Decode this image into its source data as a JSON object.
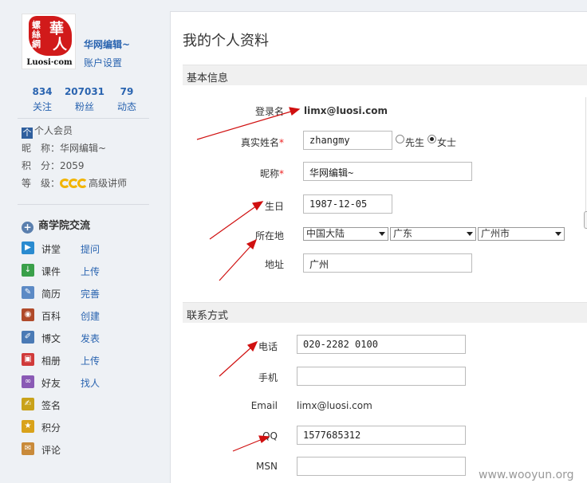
{
  "logo": {
    "seal_chars": [
      "華",
      "人",
      "螺絲網"
    ],
    "wordmark": "Luosi·com"
  },
  "user": {
    "name": "华网编辑~",
    "account_settings": "账户设置"
  },
  "stats": [
    {
      "num": "834",
      "label": "关注"
    },
    {
      "num": "207031",
      "label": "粉丝"
    },
    {
      "num": "79",
      "label": "动态"
    }
  ],
  "profile_info": {
    "member_icon": "个",
    "member": "个人会员",
    "nick_label": "昵　称：",
    "nick": "华网编辑~",
    "points_label": "积　分：",
    "points": "2059",
    "level_label": "等　级：",
    "level": "高级讲师"
  },
  "section": {
    "icon": "+",
    "title": "商学院交流"
  },
  "nav": [
    {
      "icon": "lecture-icon",
      "color": "#2a8bd0",
      "label": "讲堂",
      "action": "提问"
    },
    {
      "icon": "course-icon",
      "color": "#3aa04a",
      "label": "课件",
      "action": "上传"
    },
    {
      "icon": "resume-icon",
      "color": "#5c8ac5",
      "label": "简历",
      "action": "完善"
    },
    {
      "icon": "wiki-icon",
      "color": "#b04a2a",
      "label": "百科",
      "action": "创建"
    },
    {
      "icon": "blog-icon",
      "color": "#4a7ab5",
      "label": "博文",
      "action": "发表"
    },
    {
      "icon": "album-icon",
      "color": "#d03a3a",
      "label": "相册",
      "action": "上传"
    },
    {
      "icon": "friends-icon",
      "color": "#8a5ab5",
      "label": "好友",
      "action": "找人"
    },
    {
      "icon": "sign-icon",
      "color": "#c9a21a",
      "label": "签名",
      "action": ""
    },
    {
      "icon": "points-icon",
      "color": "#d9a21a",
      "label": "积分",
      "action": ""
    },
    {
      "icon": "comment-icon",
      "color": "#c98a3a",
      "label": "评论",
      "action": ""
    }
  ],
  "page": {
    "title": "我的个人资料"
  },
  "basic": {
    "header": "基本信息",
    "login_label": "登录名",
    "login_value": "limx@luosi.com",
    "realname_label": "真实姓名",
    "realname_value": "zhangmy",
    "gender_male": "先生",
    "gender_female": "女士",
    "gender_selected": "女士",
    "nick_label": "昵称",
    "nick_value": "华网编辑~",
    "birthday_label": "生日",
    "birthday_value": "1987-12-05",
    "location_label": "所在地",
    "country": "中国大陆",
    "province": "广东",
    "city": "广州市",
    "address_label": "地址",
    "address_value": "广州"
  },
  "contact": {
    "header": "联系方式",
    "phone_label": "电话",
    "phone_value": "020-2282 0100",
    "mobile_label": "手机",
    "mobile_value": "",
    "email_label": "Email",
    "email_value": "limx@luosi.com",
    "qq_label": "QQ",
    "qq_value": "1577685312",
    "msn_label": "MSN",
    "msn_value": ""
  },
  "required_mark": "*",
  "watermark": "www.wooyun.org",
  "colors": {
    "link": "#2a64b0",
    "required": "#e22222",
    "annotation_arrow": "#d01010"
  }
}
